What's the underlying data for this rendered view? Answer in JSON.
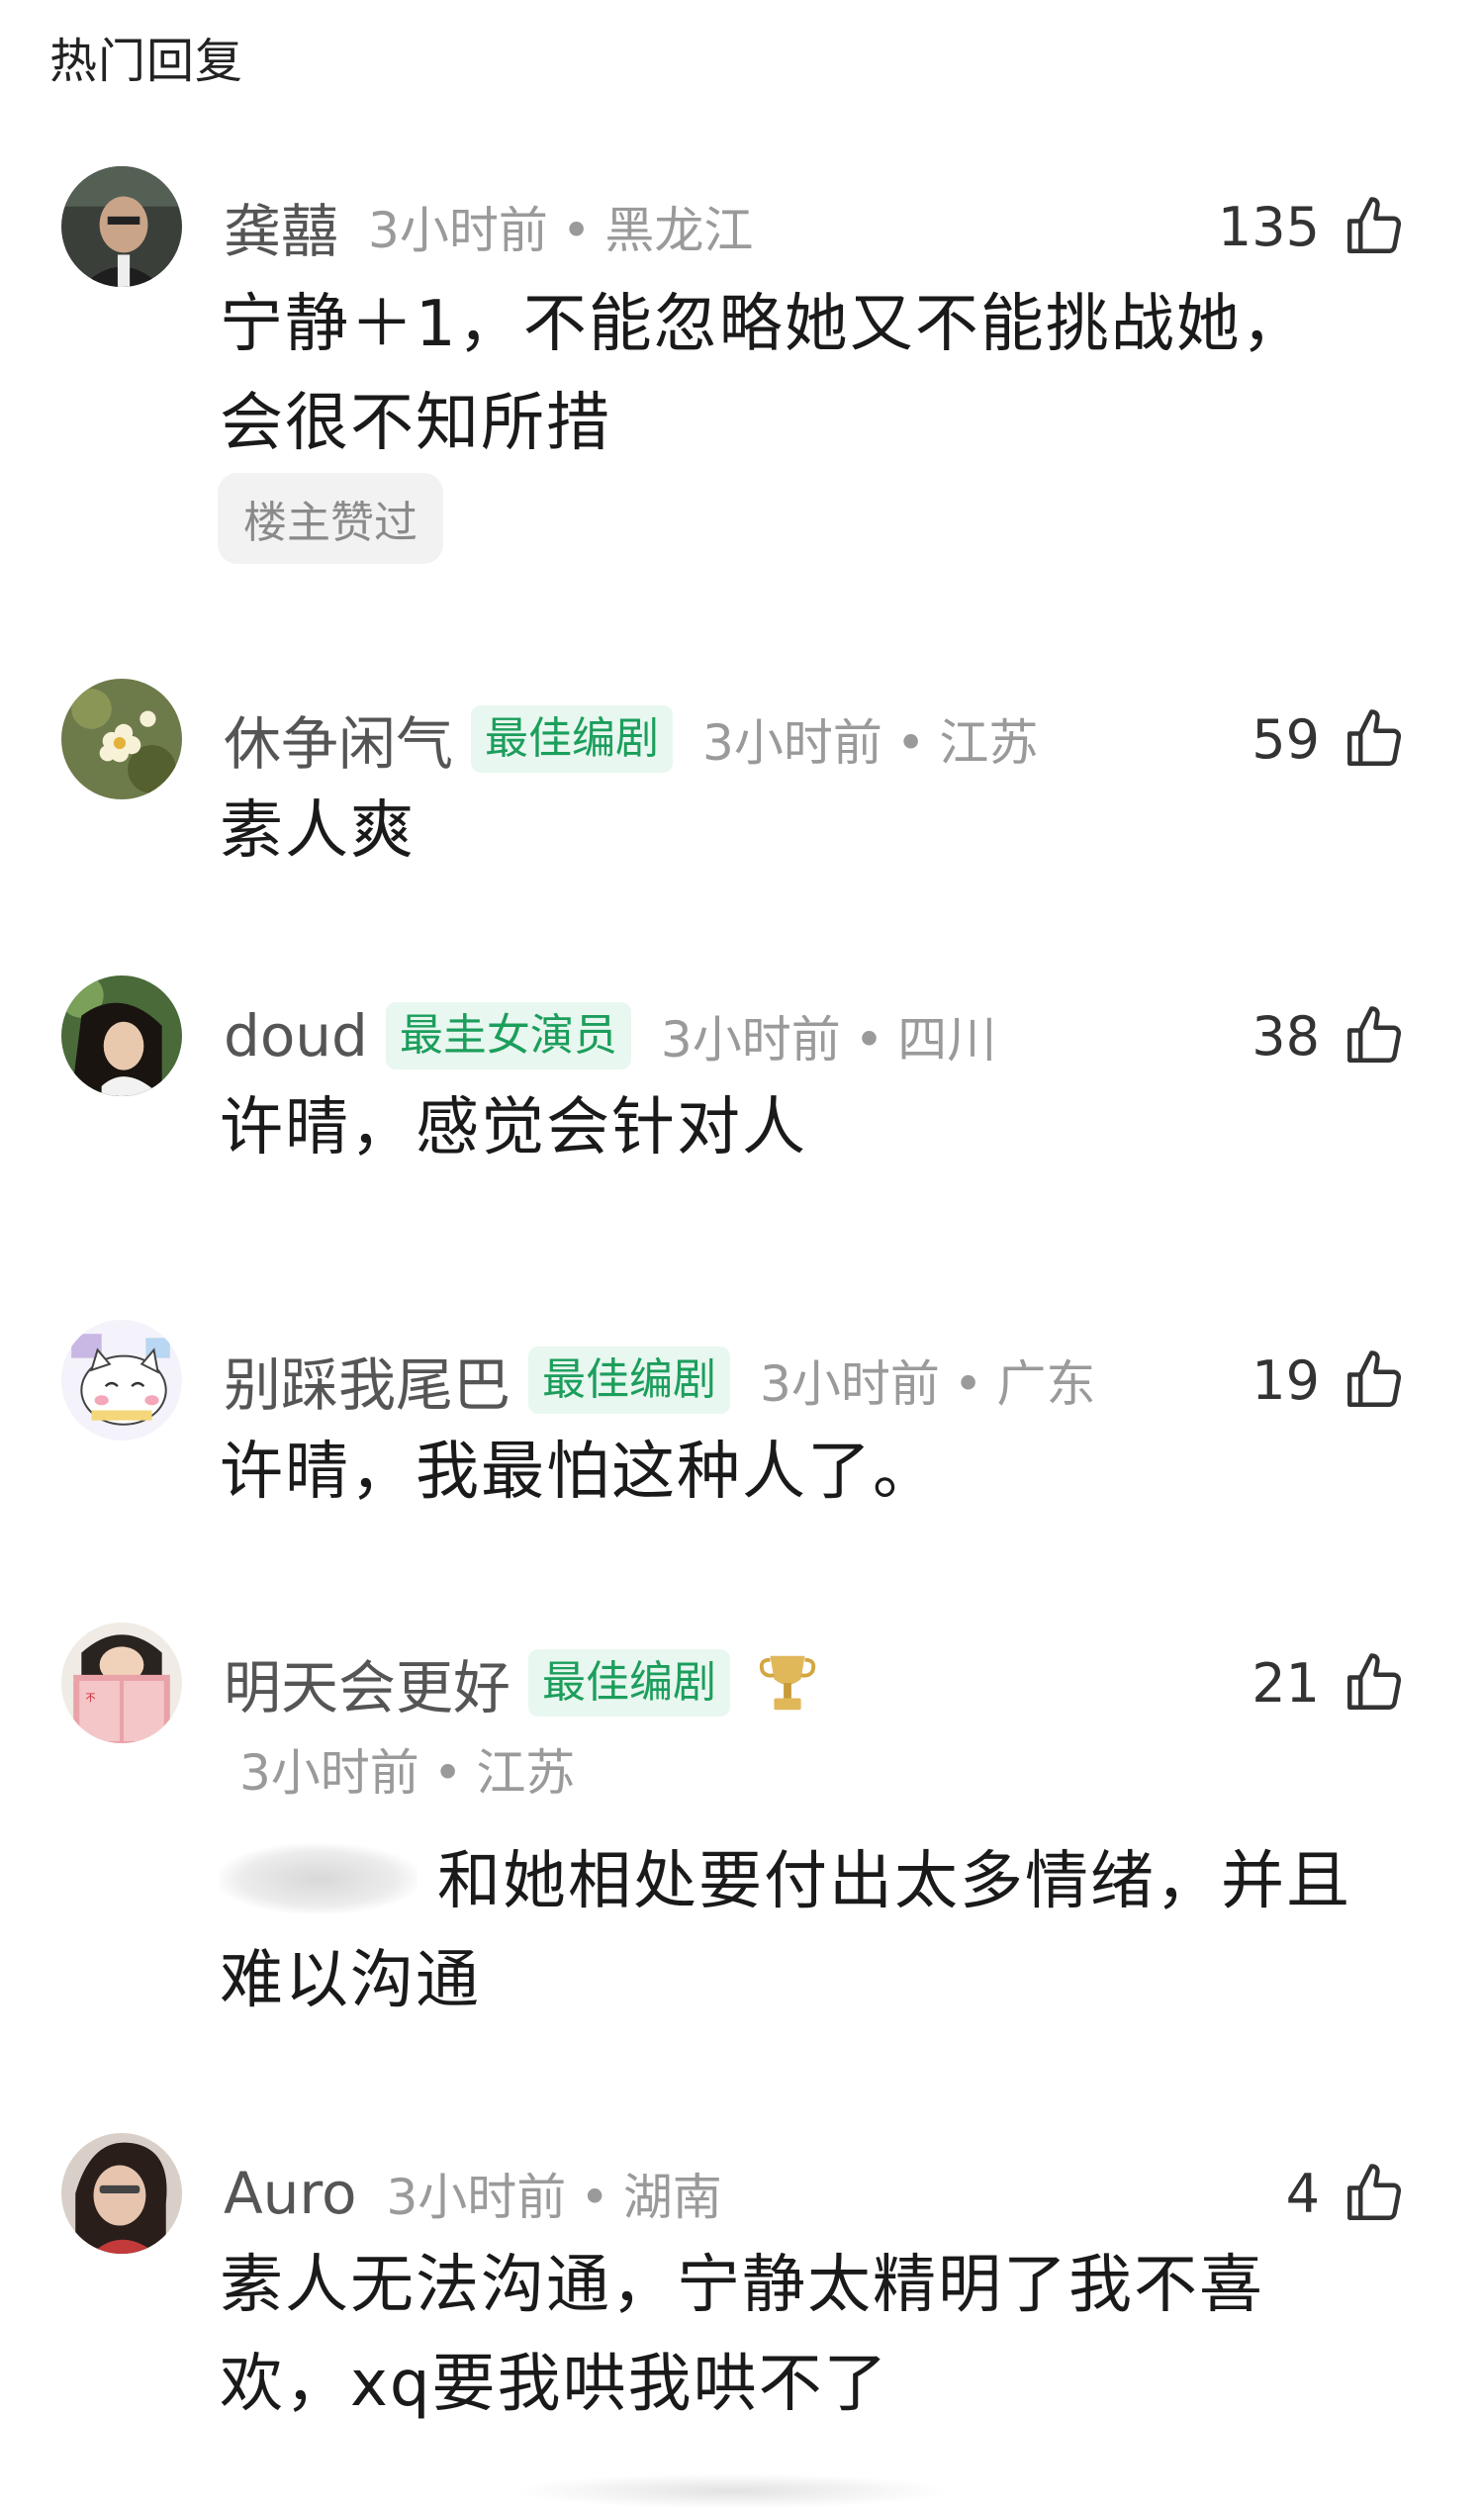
{
  "section_title": "热门回复",
  "comments": [
    {
      "username": "龚囍",
      "badge": "",
      "time": "3小时前",
      "location": "黑龙江",
      "likes": "135",
      "text": "宁静＋1，不能忽略她又不能挑战她，会很不知所措",
      "tag": "楼主赞过",
      "avatar_icon": "person-photo-avatar"
    },
    {
      "username": "休争闲气",
      "badge": "最佳编剧",
      "time": "3小时前",
      "location": "江苏",
      "likes": "59",
      "text": "素人爽",
      "avatar_icon": "flower-avatar"
    },
    {
      "username": "doud",
      "badge": "最圭女演员",
      "time": "3小时前",
      "location": "四川",
      "likes": "38",
      "text": "许晴，感觉会针对人",
      "avatar_icon": "girl-photo-avatar"
    },
    {
      "username": "别踩我尾巴",
      "badge": "最佳编剧",
      "time": "3小时前",
      "location": "广东",
      "likes": "19",
      "text": "许晴，我最怕这种人了。",
      "avatar_icon": "cartoon-cat-avatar"
    },
    {
      "username": "明天会更好",
      "badge": "最佳编剧",
      "time": "3小时前",
      "location": "江苏",
      "likes": "21",
      "text_blurred_prefix": "郑爽",
      "text": "和她相处要付出太多情绪，并且难以沟通",
      "medal_icon": "trophy-icon",
      "avatar_icon": "reading-book-avatar"
    },
    {
      "username": "Auro",
      "badge": "",
      "time": "3小时前",
      "location": "湖南",
      "likes": "4",
      "text": "素人无法沟通，宁静太精明了我不喜欢，xq要我哄我哄不了",
      "avatar_icon": "woman-photo-avatar"
    }
  ],
  "colors": {
    "badge_bg": "#e8f7ef",
    "badge_text": "#1c9e5c",
    "meta_text": "#9a9a9a",
    "username_text": "#555555"
  }
}
